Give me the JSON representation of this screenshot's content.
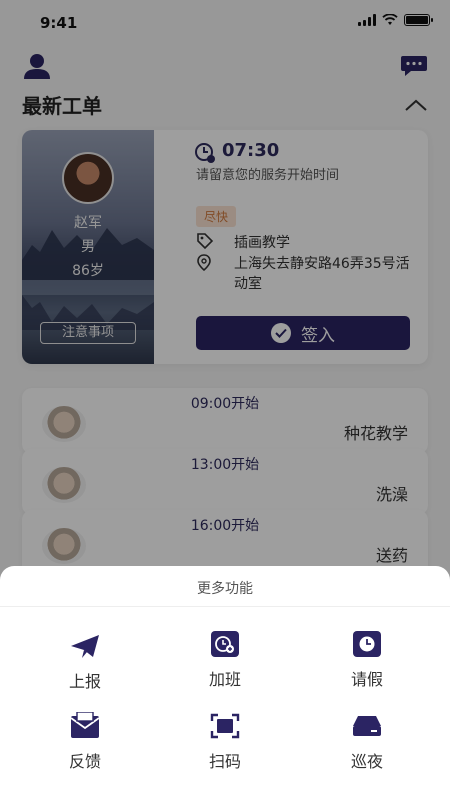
{
  "status_bar": {
    "time": "9:41"
  },
  "header": {
    "section_title": "最新工单"
  },
  "current_order": {
    "person": {
      "name": "赵军",
      "gender": "男",
      "age": "86岁"
    },
    "notes_button": "注意事项",
    "start_time": "07:30",
    "time_hint": "请留意您的服务开始时间",
    "urgency_tag": "尽快",
    "service_type": "插画教学",
    "address": "上海失去静安路46弄35号活动室",
    "checkin_button": "签入"
  },
  "upcoming_tasks": [
    {
      "time": "09:00开始",
      "name": "种花教学"
    },
    {
      "time": "13:00开始",
      "name": "洗澡"
    },
    {
      "time": "16:00开始",
      "name": "送药"
    }
  ],
  "more_functions": {
    "title": "更多功能",
    "items": [
      {
        "label": "上报",
        "icon": "paper-plane-icon"
      },
      {
        "label": "加班",
        "icon": "clock-plus-icon"
      },
      {
        "label": "请假",
        "icon": "clock-icon"
      },
      {
        "label": "反馈",
        "icon": "envelope-icon"
      },
      {
        "label": "扫码",
        "icon": "scan-icon"
      },
      {
        "label": "巡夜",
        "icon": "drive-icon"
      }
    ]
  },
  "colors": {
    "brand": "#2b2463",
    "urgent_bg": "#fbe3d2",
    "urgent_text": "#d07a3e"
  }
}
